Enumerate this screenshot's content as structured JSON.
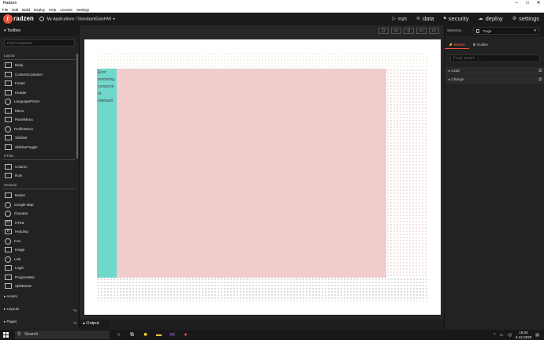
{
  "window": {
    "title": "Radzen",
    "min": "–",
    "max": "□",
    "close": "✕"
  },
  "menubar": [
    "File",
    "Edit",
    "Build",
    "Deploy",
    "Help",
    "License",
    "Settings"
  ],
  "header": {
    "logo_glyph": "r",
    "logo_text": "radzen",
    "breadcrumb": "My Applications / StandaardGainHMI",
    "nav": [
      {
        "label": "run",
        "icon": "play-icon",
        "glyph": "▷"
      },
      {
        "label": "data",
        "icon": "database-icon",
        "glyph": "≋"
      },
      {
        "label": "security",
        "icon": "lock-icon",
        "glyph": "🔒︎"
      },
      {
        "label": "deploy",
        "icon": "cloud-icon",
        "glyph": "☁"
      },
      {
        "label": "settings",
        "icon": "gear-icon",
        "glyph": "⚙"
      }
    ]
  },
  "toolbox": {
    "title": "Toolbox",
    "search_placeholder": "Find component",
    "sections": {
      "layout": "Layout",
      "html": "HTML",
      "general": "General"
    },
    "layout_items": [
      "Body",
      "ContentContainer",
      "Footer",
      "Header",
      "LanguagePicker",
      "Menu",
      "PanelMenu",
      "ProfileMenu",
      "Sidebar",
      "SidebarToggle"
    ],
    "html_items": [
      "Column",
      "Row"
    ],
    "general_items": [
      "Button",
      "Google Map",
      "Gravatar",
      "HTML",
      "Heading",
      "Icon",
      "Image",
      "Link",
      "Login",
      "ProgressBar",
      "SplitButton"
    ],
    "groups": [
      "Assets",
      "Layouts",
      "Pages"
    ]
  },
  "output_tab": "Output",
  "canvas": {
    "error_text": "Error rendering component sidebar0."
  },
  "properties": {
    "selection_label": "Selection",
    "selection_value": "Page",
    "tabs": [
      "Events",
      "Outline"
    ],
    "find_event_placeholder": "Find event ...",
    "events": [
      "Load",
      "Change"
    ]
  },
  "taskbar": {
    "search": "Search",
    "time": "16:34",
    "date": "4-12-2020"
  },
  "colors": {
    "accent": "#e8553e",
    "sidebar": "#6fd8cb",
    "body": "#f1cccc"
  }
}
